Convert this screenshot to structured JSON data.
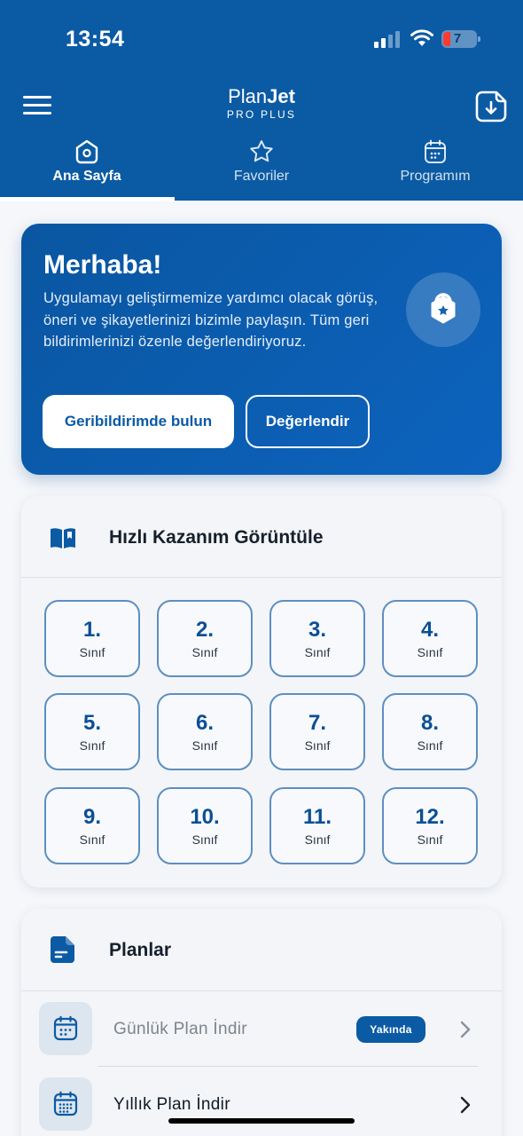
{
  "status_bar": {
    "time": "13:54",
    "battery": "7"
  },
  "header": {
    "brand_plan": "Plan",
    "brand_jet": "Jet",
    "brand_sub": "PRO PLUS"
  },
  "tabs": [
    {
      "label": "Ana Sayfa",
      "icon": "home-icon",
      "active": true
    },
    {
      "label": "Favoriler",
      "icon": "star-icon",
      "active": false
    },
    {
      "label": "Programım",
      "icon": "calendar-icon",
      "active": false
    }
  ],
  "hero": {
    "title": "Merhaba!",
    "text": "Uygulamayı geliştirmemize yardımcı olacak görüş, öneri ve şikayetlerinizi bizimle paylaşın. Tüm geri bildirimlerinizi özenle değerlendiriyoruz.",
    "primary_button": "Geribildirimde bulun",
    "secondary_button": "Değerlendir",
    "badge_icon": "bag-star-icon"
  },
  "quick": {
    "title": "Hızlı Kazanım Görüntüle",
    "icon": "book-icon",
    "grades": [
      {
        "num": "1.",
        "label": "Sınıf"
      },
      {
        "num": "2.",
        "label": "Sınıf"
      },
      {
        "num": "3.",
        "label": "Sınıf"
      },
      {
        "num": "4.",
        "label": "Sınıf"
      },
      {
        "num": "5.",
        "label": "Sınıf"
      },
      {
        "num": "6.",
        "label": "Sınıf"
      },
      {
        "num": "7.",
        "label": "Sınıf"
      },
      {
        "num": "8.",
        "label": "Sınıf"
      },
      {
        "num": "9.",
        "label": "Sınıf"
      },
      {
        "num": "10.",
        "label": "Sınıf"
      },
      {
        "num": "11.",
        "label": "Sınıf"
      },
      {
        "num": "12.",
        "label": "Sınıf"
      }
    ]
  },
  "plans": {
    "title": "Planlar",
    "icon": "document-icon",
    "items": [
      {
        "label": "Günlük Plan İndir",
        "badge": "Yakında",
        "icon": "calendar-icon"
      },
      {
        "label": "Yıllık Plan İndir",
        "icon": "calendar-icon"
      }
    ]
  },
  "colors": {
    "brand_blue": "#0b5aa4",
    "grade_border": "#5d8fc0"
  }
}
